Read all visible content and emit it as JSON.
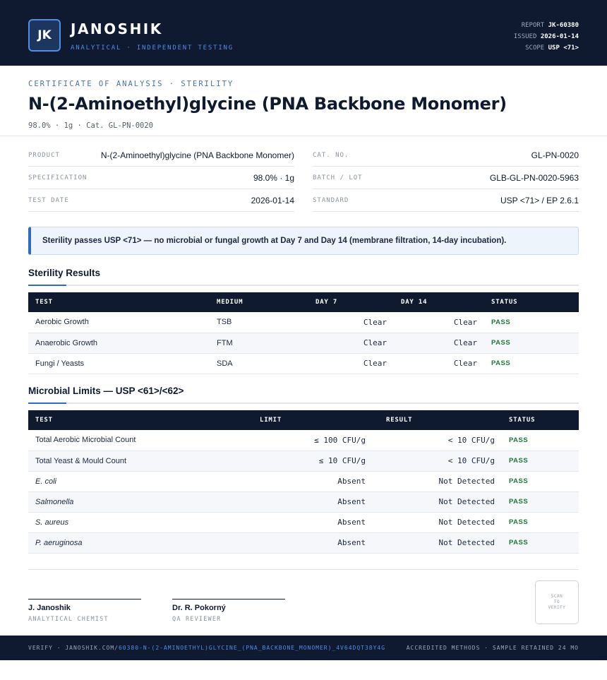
{
  "header": {
    "logo_initials": "JK",
    "brand": "JANOSHIK",
    "tagline": "ANALYTICAL · INDEPENDENT TESTING",
    "report_label": "REPORT",
    "report_value": "JK-60380",
    "issued_label": "ISSUED",
    "issued_value": "2026-01-14",
    "scope_label": "SCOPE",
    "scope_value": "USP <71>"
  },
  "doc": {
    "eyebrow": "CERTIFICATE OF ANALYSIS · STERILITY",
    "title": "N-(2-Aminoethyl)glycine (PNA Backbone Monomer)",
    "subtitle": "98.0% · 1g  ·  Cat. GL-PN-0020"
  },
  "info_left": [
    {
      "label": "PRODUCT",
      "value": "N-(2-Aminoethyl)glycine (PNA Backbone Monomer)"
    },
    {
      "label": "SPECIFICATION",
      "value": "98.0% · 1g"
    },
    {
      "label": "TEST DATE",
      "value": "2026-01-14"
    }
  ],
  "info_right": [
    {
      "label": "CAT. NO.",
      "value": "GL-PN-0020"
    },
    {
      "label": "BATCH / LOT",
      "value": "GLB-GL-PN-0020-5963"
    },
    {
      "label": "STANDARD",
      "value": "USP <71> / EP 2.6.1"
    }
  ],
  "banner": "Sterility passes USP <71> — no microbial or fungal growth at Day 7 and Day 14 (membrane filtration, 14-day incubation).",
  "sterility": {
    "title": "Sterility Results",
    "headers": [
      "TEST",
      "MEDIUM",
      "DAY 7",
      "DAY 14",
      "STATUS"
    ],
    "rows": [
      {
        "test": "Aerobic Growth",
        "medium": "TSB",
        "day7": "Clear",
        "day14": "Clear",
        "status": "PASS"
      },
      {
        "test": "Anaerobic Growth",
        "medium": "FTM",
        "day7": "Clear",
        "day14": "Clear",
        "status": "PASS"
      },
      {
        "test": "Fungi / Yeasts",
        "medium": "SDA",
        "day7": "Clear",
        "day14": "Clear",
        "status": "PASS"
      }
    ]
  },
  "microbial": {
    "title": "Microbial Limits — USP <61>/<62>",
    "headers": [
      "TEST",
      "LIMIT",
      "RESULT",
      "STATUS"
    ],
    "rows": [
      {
        "test": "Total Aerobic Microbial Count",
        "limit": "≤ 100 CFU/g",
        "result": "< 10 CFU/g",
        "status": "PASS"
      },
      {
        "test": "Total Yeast & Mould Count",
        "limit": "≤ 10 CFU/g",
        "result": "< 10 CFU/g",
        "status": "PASS"
      },
      {
        "test": "E. coli",
        "limit": "Absent",
        "result": "Not Detected",
        "status": "PASS"
      },
      {
        "test": "Salmonella",
        "limit": "Absent",
        "result": "Not Detected",
        "status": "PASS"
      },
      {
        "test": "S. aureus",
        "limit": "Absent",
        "result": "Not Detected",
        "status": "PASS"
      },
      {
        "test": "P. aeruginosa",
        "limit": "Absent",
        "result": "Not Detected",
        "status": "PASS"
      }
    ]
  },
  "signatures": [
    {
      "name": "J. Janoshik",
      "role": "ANALYTICAL CHEMIST"
    },
    {
      "name": "Dr. R. Pokorný",
      "role": "QA REVIEWER"
    }
  ],
  "qr": {
    "line1": "SCAN",
    "line2": "TO",
    "line3": "VERIFY"
  },
  "footer": {
    "verify_prefix": "VERIFY · JANOSHIK.COM/",
    "verify_path": "60380-N-(2-AMINOETHYL)GLYCINE_(PNA_BACKBONE_MONOMER)_4V64DQT38Y4G",
    "right": "ACCREDITED METHODS · SAMPLE RETAINED 24 MO"
  },
  "colors": {
    "navy": "#0f1a30",
    "accent": "#2e6cc4",
    "pass": "#1f7a3a"
  }
}
